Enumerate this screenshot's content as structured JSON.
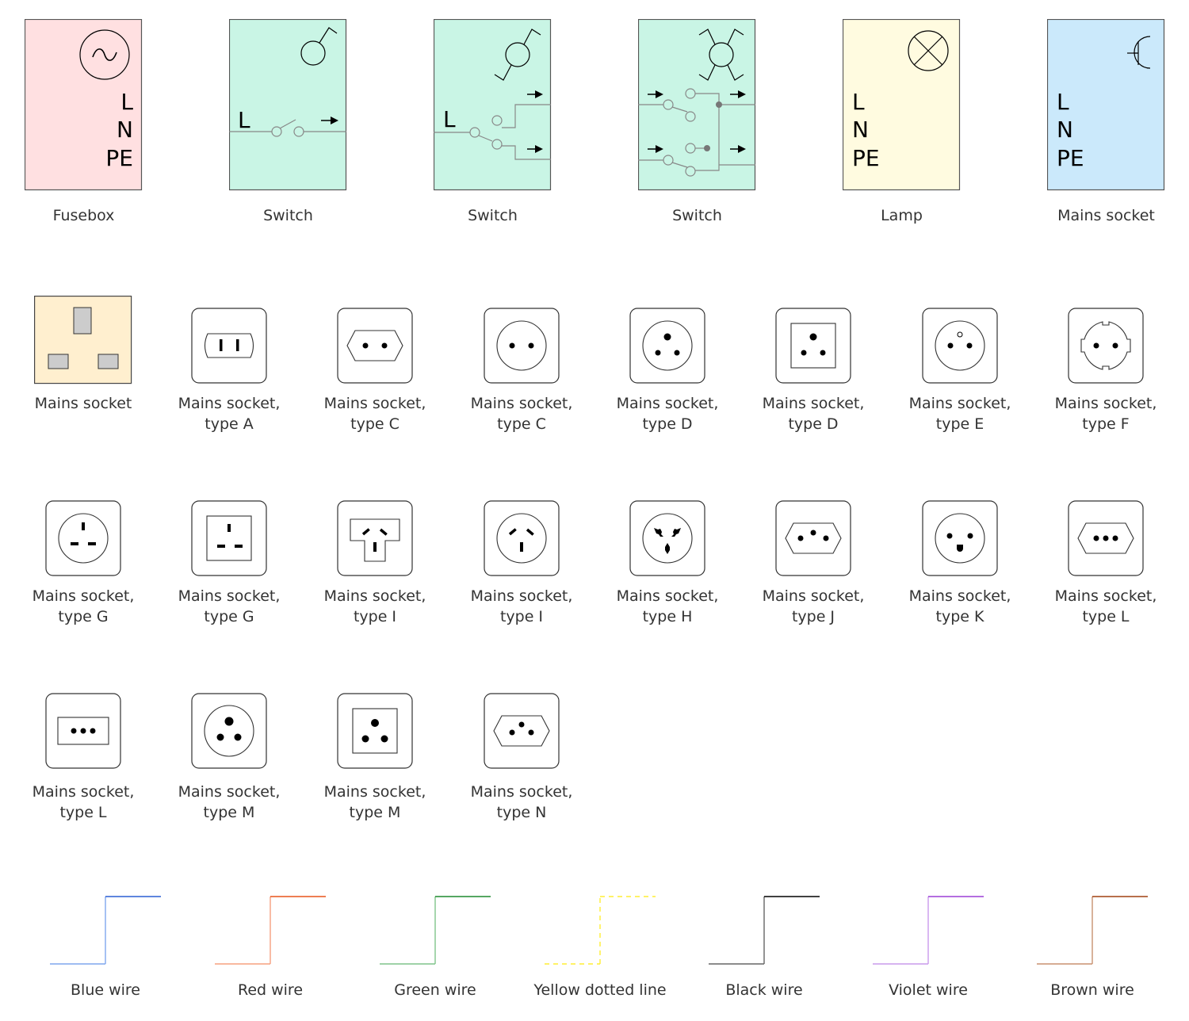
{
  "colors": {
    "fusebox_fill": "#ffe0e1",
    "switch_fill": "#c9f5e5",
    "lamp_fill": "#fffbe0",
    "mains_socket_fill": "#cbe9fb",
    "uk_socket_fill": "#ffefcf",
    "uk_pin_fill": "#cccccc",
    "outline": "#555555",
    "wire_grey": "#888888"
  },
  "row1": [
    {
      "id": "fusebox",
      "label": "Fusebox",
      "terminals": [
        "L",
        "N",
        "PE"
      ],
      "icon": "ac-source-icon"
    },
    {
      "id": "switch-1",
      "label": "Switch",
      "terminals": [
        "L"
      ],
      "icon": "single-switch-icon"
    },
    {
      "id": "switch-2",
      "label": "Switch",
      "terminals": [
        "L"
      ],
      "icon": "two-way-switch-icon"
    },
    {
      "id": "switch-3",
      "label": "Switch",
      "terminals": [],
      "icon": "intermediate-switch-icon"
    },
    {
      "id": "lamp",
      "label": "Lamp",
      "terminals": [
        "L",
        "N",
        "PE"
      ],
      "icon": "lamp-icon"
    },
    {
      "id": "mains-socket",
      "label": "Mains socket",
      "terminals": [
        "L",
        "N",
        "PE"
      ],
      "icon": "socket-symbol-icon"
    }
  ],
  "sockets": [
    {
      "type": "uk",
      "line1": "Mains socket",
      "line2": ""
    },
    {
      "type": "A",
      "line1": "Mains socket,",
      "line2": "type A"
    },
    {
      "type": "C-hex",
      "line1": "Mains socket,",
      "line2": "type C"
    },
    {
      "type": "C-round",
      "line1": "Mains socket,",
      "line2": "type C"
    },
    {
      "type": "D-round",
      "line1": "Mains socket,",
      "line2": "type D"
    },
    {
      "type": "D-square",
      "line1": "Mains socket,",
      "line2": "type D"
    },
    {
      "type": "E",
      "line1": "Mains socket,",
      "line2": "type E"
    },
    {
      "type": "F",
      "line1": "Mains socket,",
      "line2": "type F"
    },
    {
      "type": "G-round",
      "line1": "Mains socket,",
      "line2": "type G"
    },
    {
      "type": "G-square",
      "line1": "Mains socket,",
      "line2": "type G"
    },
    {
      "type": "I-t",
      "line1": "Mains socket,",
      "line2": "type I"
    },
    {
      "type": "I-round",
      "line1": "Mains socket,",
      "line2": "type I"
    },
    {
      "type": "H",
      "line1": "Mains socket,",
      "line2": "type H"
    },
    {
      "type": "J",
      "line1": "Mains socket,",
      "line2": "type J"
    },
    {
      "type": "K",
      "line1": "Mains socket,",
      "line2": "type K"
    },
    {
      "type": "L-hex",
      "line1": "Mains socket,",
      "line2": "type L"
    },
    {
      "type": "L-rect",
      "line1": "Mains socket,",
      "line2": "type L"
    },
    {
      "type": "M-round",
      "line1": "Mains socket,",
      "line2": "type M"
    },
    {
      "type": "M-square",
      "line1": "Mains socket,",
      "line2": "type M"
    },
    {
      "type": "N",
      "line1": "Mains socket,",
      "line2": "type N"
    }
  ],
  "wires": [
    {
      "label": "Blue wire",
      "color": "#2a5fd4",
      "light": "#7ea6ee",
      "dashed": false
    },
    {
      "label": "Red wire",
      "color": "#e8541a",
      "light": "#f5a07e",
      "dashed": false
    },
    {
      "label": "Green wire",
      "color": "#1f8a2e",
      "light": "#7fc48a",
      "dashed": false
    },
    {
      "label": "Yellow dotted line",
      "color": "#ffee33",
      "light": "#ffee33",
      "dashed": true
    },
    {
      "label": "Black wire",
      "color": "#000000",
      "light": "#666666",
      "dashed": false
    },
    {
      "label": "Violet wire",
      "color": "#9b3fd6",
      "light": "#c99aec",
      "dashed": false
    },
    {
      "label": "Brown wire",
      "color": "#a04010",
      "light": "#c89070",
      "dashed": false
    }
  ]
}
